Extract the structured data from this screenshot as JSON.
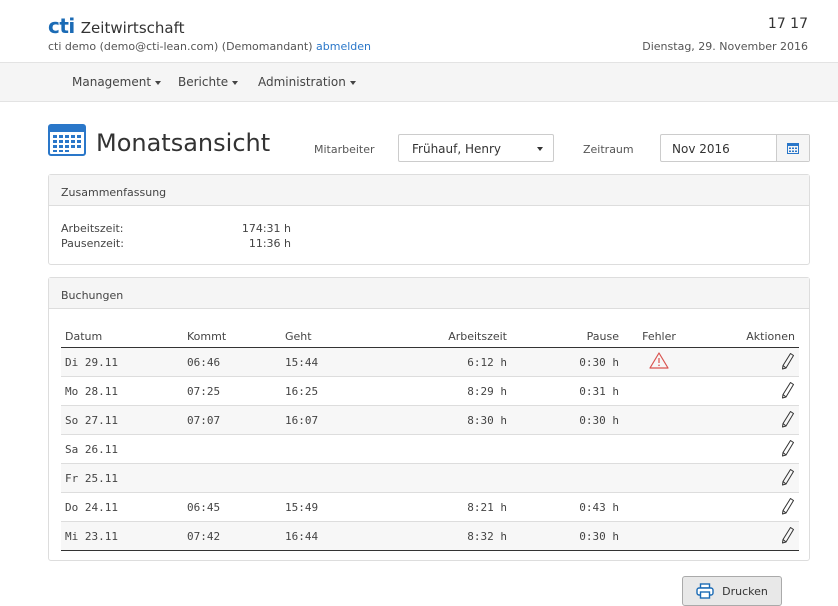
{
  "header": {
    "logo": "cti",
    "app_name": "Zeitwirtschaft",
    "user_text": "cti demo (demo@cti-lean.com) (Demomandant)",
    "logout_link": "abmelden",
    "clock": "17 17",
    "date": "Dienstag, 29. November 2016"
  },
  "nav": {
    "items": [
      {
        "label": "Management"
      },
      {
        "label": "Berichte"
      },
      {
        "label": "Administration"
      }
    ]
  },
  "page": {
    "title": "Monatsansicht",
    "mitarbeiter_label": "Mitarbeiter",
    "mitarbeiter_value": "Frühauf, Henry",
    "zeitraum_label": "Zeitraum",
    "zeitraum_value": "Nov 2016"
  },
  "summary": {
    "title": "Zusammenfassung",
    "arbeitszeit_label": "Arbeitszeit:",
    "arbeitszeit_value": "174:31 h",
    "pausenzeit_label": "Pausenzeit:",
    "pausenzeit_value": "11:36 h"
  },
  "bookings": {
    "title": "Buchungen",
    "columns": [
      "Datum",
      "Kommt",
      "Geht",
      "Arbeitszeit",
      "Pause",
      "Fehler",
      "Aktionen"
    ],
    "rows": [
      {
        "datum": "Di 29.11",
        "kommt": "06:46",
        "geht": "15:44",
        "arbeitszeit": "6:12 h",
        "pause": "0:30 h",
        "fehler": "warning-icon"
      },
      {
        "datum": "Mo 28.11",
        "kommt": "07:25",
        "geht": "16:25",
        "arbeitszeit": "8:29 h",
        "pause": "0:31 h",
        "fehler": ""
      },
      {
        "datum": "So 27.11",
        "kommt": "07:07",
        "geht": "16:07",
        "arbeitszeit": "8:30 h",
        "pause": "0:30 h",
        "fehler": ""
      },
      {
        "datum": "Sa 26.11",
        "kommt": "",
        "geht": "",
        "arbeitszeit": "",
        "pause": "",
        "fehler": ""
      },
      {
        "datum": "Fr 25.11",
        "kommt": "",
        "geht": "",
        "arbeitszeit": "",
        "pause": "",
        "fehler": ""
      },
      {
        "datum": "Do 24.11",
        "kommt": "06:45",
        "geht": "15:49",
        "arbeitszeit": "8:21 h",
        "pause": "0:43 h",
        "fehler": ""
      },
      {
        "datum": "Mi 23.11",
        "kommt": "07:42",
        "geht": "16:44",
        "arbeitszeit": "8:32 h",
        "pause": "0:30 h",
        "fehler": ""
      }
    ]
  },
  "print_button": "Drucken",
  "colors": {
    "brand": "#1b6bb5",
    "link": "#2a77c9",
    "warning": "#d9534f"
  }
}
